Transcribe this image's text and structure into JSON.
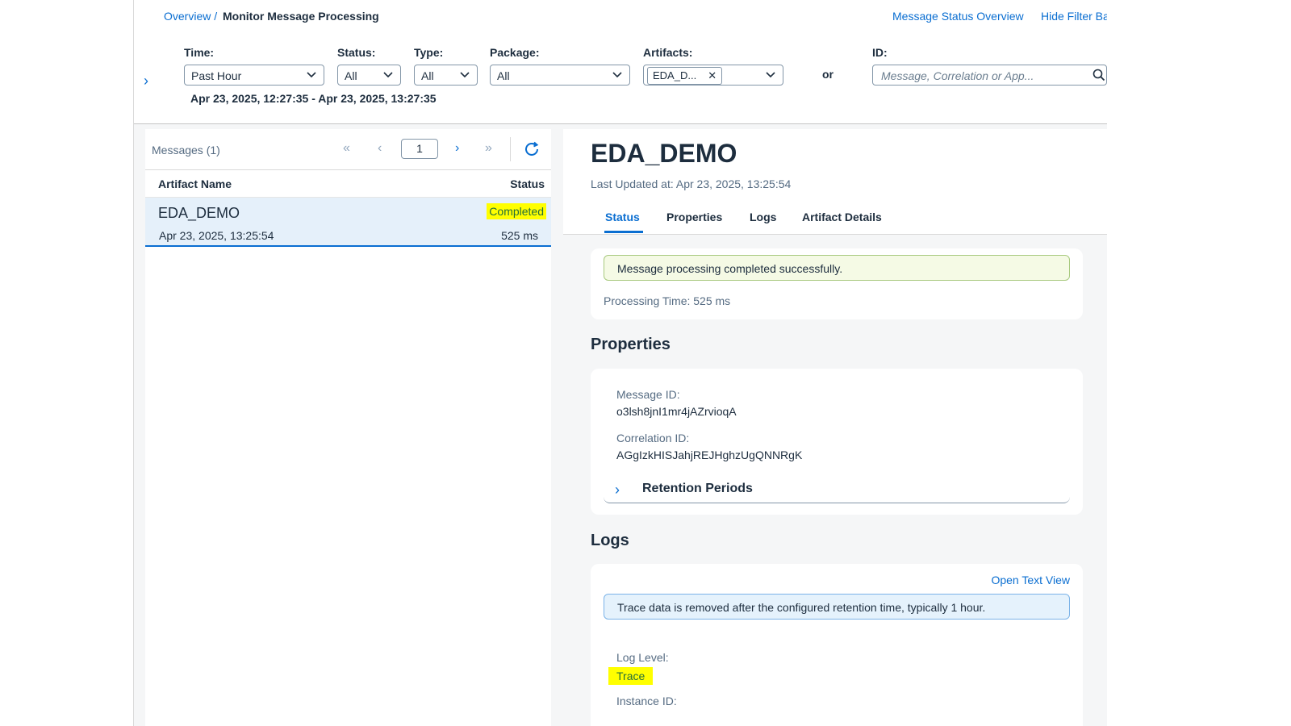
{
  "header": {
    "breadcrumb_link": "Overview /",
    "title": "Monitor Message Processing",
    "link_status_overview": "Message Status Overview",
    "link_hide_filter": "Hide Filter Ba"
  },
  "filters": {
    "time_label": "Time:",
    "time_value": "Past Hour",
    "status_label": "Status:",
    "status_value": "All",
    "type_label": "Type:",
    "type_value": "All",
    "package_label": "Package:",
    "package_value": "All",
    "artifacts_label": "Artifacts:",
    "artifacts_token": "EDA_D...",
    "or_label": "or",
    "id_label": "ID:",
    "id_placeholder": "Message, Correlation or App...",
    "range": "Apr 23, 2025, 12:27:35 - Apr 23, 2025, 13:27:35"
  },
  "list": {
    "count": "Messages (1)",
    "page": "1",
    "col_artifact": "Artifact Name",
    "col_status": "Status",
    "rows": [
      {
        "name": "EDA_DEMO",
        "status": "Completed",
        "date": "Apr 23, 2025, 13:25:54",
        "duration": "525 ms"
      }
    ]
  },
  "detail": {
    "title": "EDA_DEMO",
    "updated": "Last Updated at: Apr 23, 2025, 13:25:54",
    "tabs": [
      "Status",
      "Properties",
      "Logs",
      "Artifact Details"
    ],
    "status_message": "Message processing completed successfully.",
    "processing_time": "Processing Time: 525 ms",
    "properties_title": "Properties",
    "message_id_label": "Message ID:",
    "message_id": "o3lsh8jnI1mr4jAZrvioqA",
    "correlation_id_label": "Correlation ID:",
    "correlation_id": "AGgIzkHISJahjREJHghzUgQNNRgK",
    "retention": "Retention Periods",
    "logs_title": "Logs",
    "open_text_view": "Open Text View",
    "trace_info": "Trace data is removed after the configured retention time, typically 1 hour.",
    "log_level_label": "Log Level:",
    "log_level": "Trace",
    "instance_id_label": "Instance ID:"
  },
  "colors": {
    "accent": "#0a6ed1",
    "highlight": "#ffff00",
    "success_bg": "#f5fae5",
    "info_bg": "#e5f2fc"
  }
}
